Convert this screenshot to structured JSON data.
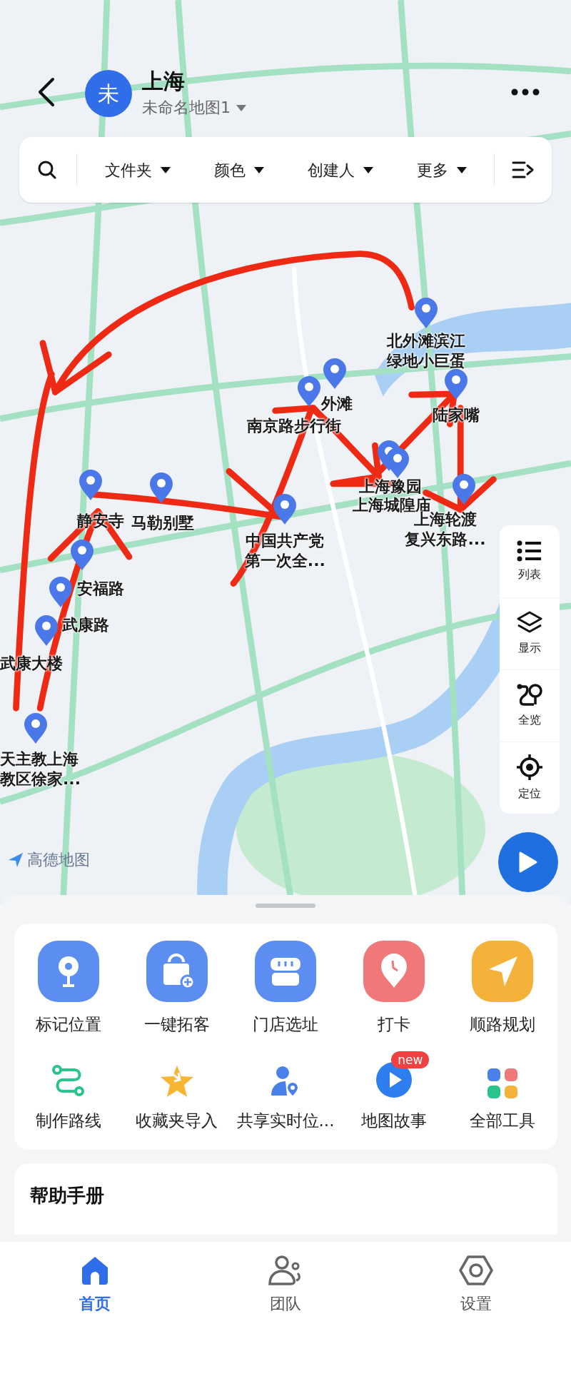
{
  "header": {
    "avatar": "未",
    "title": "上海",
    "subtitle": "未命名地图1"
  },
  "filters": [
    {
      "label": "文件夹"
    },
    {
      "label": "颜色"
    },
    {
      "label": "创建人"
    },
    {
      "label": "更多"
    }
  ],
  "pins": [
    {
      "lines": [
        "北外滩滨江",
        "绿地小巨蛋"
      ]
    },
    {
      "lines": [
        "外滩"
      ]
    },
    {
      "lines": [
        "南京路步行街"
      ]
    },
    {
      "lines": [
        "陆家嘴"
      ]
    },
    {
      "lines": [
        "上海豫园"
      ]
    },
    {
      "lines": [
        "上海城隍庙"
      ]
    },
    {
      "lines": [
        "上海轮渡",
        "复兴东路..."
      ]
    },
    {
      "lines": [
        "中国共产党",
        "第一次全..."
      ]
    },
    {
      "lines": [
        "静安寺"
      ]
    },
    {
      "lines": [
        "马勒别墅"
      ]
    },
    {
      "lines": [
        "安福路"
      ]
    },
    {
      "lines": [
        "武康路"
      ]
    },
    {
      "lines": [
        "武康大楼"
      ]
    },
    {
      "lines": [
        "天主教上海",
        "教区徐家..."
      ]
    }
  ],
  "side_controls": [
    {
      "label": "列表"
    },
    {
      "label": "显示"
    },
    {
      "label": "全览"
    },
    {
      "label": "定位"
    }
  ],
  "map_attribution": "高德地图",
  "tools": [
    {
      "label": "标记位置"
    },
    {
      "label": "一键拓客"
    },
    {
      "label": "门店选址"
    },
    {
      "label": "打卡"
    },
    {
      "label": "顺路规划"
    },
    {
      "label": "制作路线"
    },
    {
      "label": "收藏夹导入"
    },
    {
      "label": "共享实时位..."
    },
    {
      "label": "地图故事",
      "badge": "new"
    },
    {
      "label": "全部工具"
    }
  ],
  "help": {
    "title": "帮助手册"
  },
  "nav": [
    {
      "label": "首页",
      "selected": true
    },
    {
      "label": "团队",
      "selected": false
    },
    {
      "label": "设置",
      "selected": false
    }
  ]
}
